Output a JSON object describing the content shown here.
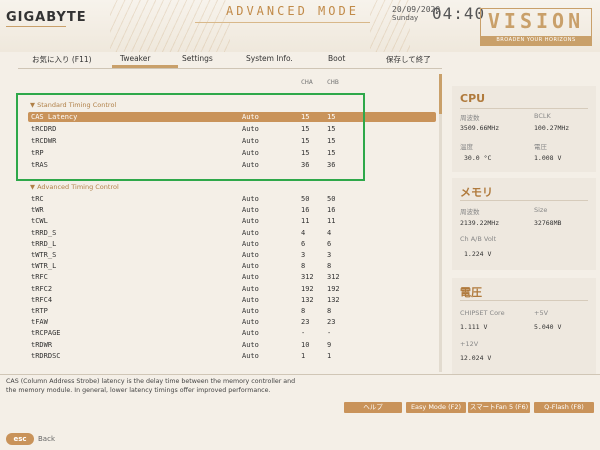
{
  "header": {
    "logo": "GIGABYTE",
    "mode": "ADVANCED MODE",
    "date": "20/09/2020",
    "day": "Sunday",
    "time": "04:40",
    "vision_title": "VISION",
    "vision_sub": "BROADEN YOUR HORIZONS"
  },
  "tabs": [
    {
      "label": "お気に入り (F11)"
    },
    {
      "label": "Tweaker"
    },
    {
      "label": "Settings"
    },
    {
      "label": "System Info."
    },
    {
      "label": "Boot"
    },
    {
      "label": "保存して終了"
    }
  ],
  "columns": {
    "cha": "CHA",
    "chb": "CHB"
  },
  "sections": {
    "standard": "▼ Standard Timing Control",
    "advanced": "▼ Advanced Timing Control"
  },
  "standard_rows": [
    {
      "name": "CAS Latency",
      "mode": "Auto",
      "cha": "15",
      "chb": "15"
    },
    {
      "name": "tRCDRD",
      "mode": "Auto",
      "cha": "15",
      "chb": "15"
    },
    {
      "name": "tRCDWR",
      "mode": "Auto",
      "cha": "15",
      "chb": "15"
    },
    {
      "name": "tRP",
      "mode": "Auto",
      "cha": "15",
      "chb": "15"
    },
    {
      "name": "tRAS",
      "mode": "Auto",
      "cha": "36",
      "chb": "36"
    }
  ],
  "advanced_rows": [
    {
      "name": "tRC",
      "mode": "Auto",
      "cha": "50",
      "chb": "50"
    },
    {
      "name": "tWR",
      "mode": "Auto",
      "cha": "16",
      "chb": "16"
    },
    {
      "name": "tCWL",
      "mode": "Auto",
      "cha": "11",
      "chb": "11"
    },
    {
      "name": "tRRD_S",
      "mode": "Auto",
      "cha": "4",
      "chb": "4"
    },
    {
      "name": "tRRD_L",
      "mode": "Auto",
      "cha": "6",
      "chb": "6"
    },
    {
      "name": "tWTR_S",
      "mode": "Auto",
      "cha": "3",
      "chb": "3"
    },
    {
      "name": "tWTR_L",
      "mode": "Auto",
      "cha": "8",
      "chb": "8"
    },
    {
      "name": "tRFC",
      "mode": "Auto",
      "cha": "312",
      "chb": "312"
    },
    {
      "name": "tRFC2",
      "mode": "Auto",
      "cha": "192",
      "chb": "192"
    },
    {
      "name": "tRFC4",
      "mode": "Auto",
      "cha": "132",
      "chb": "132"
    },
    {
      "name": "tRTP",
      "mode": "Auto",
      "cha": "8",
      "chb": "8"
    },
    {
      "name": "tFAW",
      "mode": "Auto",
      "cha": "23",
      "chb": "23"
    },
    {
      "name": "tRCPAGE",
      "mode": "Auto",
      "cha": "-",
      "chb": "-"
    },
    {
      "name": "tRDWR",
      "mode": "Auto",
      "cha": "10",
      "chb": "9"
    },
    {
      "name": "tRDRDSC",
      "mode": "Auto",
      "cha": "1",
      "chb": "1"
    }
  ],
  "cpu": {
    "title": "CPU",
    "freq_label": "周波数",
    "freq_value": "3509.66MHz",
    "bclk_label": "BCLK",
    "bclk_value": "100.27MHz",
    "temp_label": "温度",
    "temp_value": "30.0 °C",
    "volt_label": "電圧",
    "volt_value": "1.008 V"
  },
  "memory": {
    "title": "メモリ",
    "freq_label": "周波数",
    "freq_value": "2139.22MHz",
    "size_label": "Size",
    "size_value": "32768MB",
    "volt_label": "Ch A/B Volt",
    "volt_value": "1.224 V"
  },
  "voltage": {
    "title": "電圧",
    "chipset_label": "CHIPSET Core",
    "chipset_value": "1.111 V",
    "p5_label": "+5V",
    "p5_value": "5.040 V",
    "p12_label": "+12V",
    "p12_value": "12.024 V"
  },
  "description": "CAS (Column Address Strobe) latency is the delay time between the memory controller and the memory module. In general, lower latency timings offer improved performance.",
  "bottom_buttons": [
    {
      "label": "ヘルプ"
    },
    {
      "label": "Easy Mode (F2)"
    },
    {
      "label": "スマートFan 5 (F6)"
    },
    {
      "label": "Q-Flash (F8)"
    }
  ],
  "esc": {
    "badge": "esc",
    "label": "Back"
  },
  "colors": {
    "accent": "#c9935a",
    "highlight_box": "#2ea84a",
    "background": "#f4efe7"
  }
}
